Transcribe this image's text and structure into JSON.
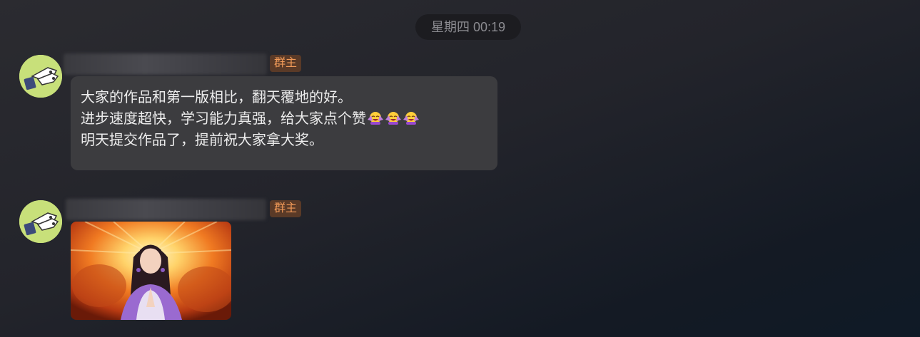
{
  "chat": {
    "timestamp": "星期四 00:19",
    "messages": [
      {
        "sender_role_badge": "群主",
        "type": "text",
        "lines": [
          "大家的作品和第一版相比，翻天覆地的好。",
          "进步速度超快，学习能力真强，给大家点个赞",
          "明天提交作品了，提前祝大家拿大奖。"
        ],
        "emoji_count": 3,
        "emoji": "clapping-face"
      },
      {
        "sender_role_badge": "群主",
        "type": "image",
        "image_subject": "praying-person-with-fiery-glow"
      }
    ]
  },
  "colors": {
    "badge_text": "#f19a58",
    "badge_bg": "#5a3a27",
    "bubble_bg": "#3c3c3f",
    "avatar_bg": "#c8e07a"
  }
}
